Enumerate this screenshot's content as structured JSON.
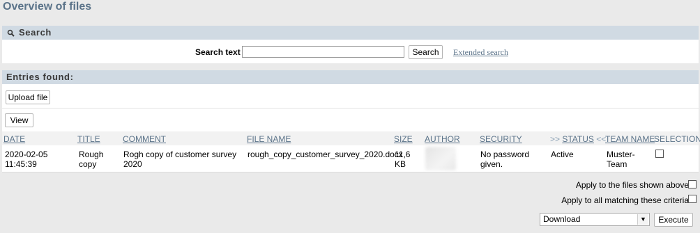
{
  "page": {
    "title": "Overview of files"
  },
  "search": {
    "heading": "Search",
    "label": "Search text",
    "value": "",
    "button": "Search",
    "extended_link": "Extended search"
  },
  "entries": {
    "heading": "Entries found:",
    "upload_button": "Upload file",
    "view_button": "View"
  },
  "table": {
    "headers": {
      "date": "DATE",
      "title": "TITLE",
      "comment": "COMMENT",
      "file_name": "FILE NAME",
      "size": "SIZE",
      "author": "AUTHOR",
      "security": "SECURITY",
      "status_prefix": ">>",
      "status": "STATUS",
      "status_suffix": "<<",
      "team_name": "TEAM NAME",
      "selection": "SELECTION"
    },
    "rows": [
      {
        "date": "2020-02-05",
        "time": "11:45:39",
        "title_1": "Rough",
        "title_2": "copy",
        "comment_1": "Rogh copy of customer survey",
        "comment_2": "2020",
        "file_name": "rough_copy_customer_survey_2020.docx",
        "size_1": "11,6",
        "size_2": "KB",
        "security_1": "No password",
        "security_2": "given.",
        "status": "Active",
        "team_1": "Muster-",
        "team_2": "Team",
        "selected": false
      }
    ]
  },
  "actions": {
    "apply_shown": "Apply to the files shown above",
    "apply_matching": "Apply to all matching these criteria",
    "action_select": "Download",
    "execute_button": "Execute"
  },
  "colors": {
    "accent": "#5b7389",
    "bar": "#d0dae3",
    "background": "#eaeaea"
  }
}
